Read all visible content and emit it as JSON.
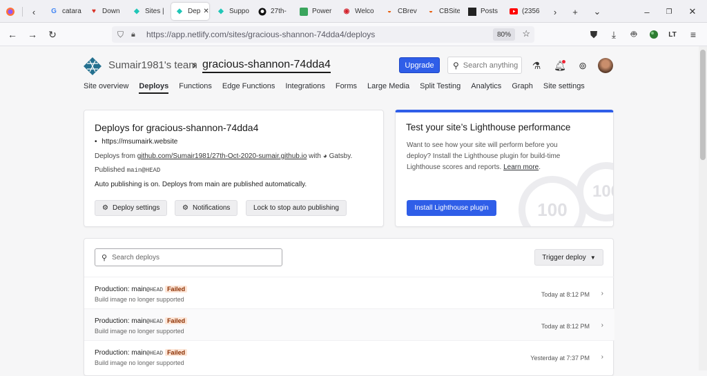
{
  "browser": {
    "tabs": [
      {
        "label": "catara",
        "icon": "google-icon"
      },
      {
        "label": "Down",
        "icon": "heart-icon"
      },
      {
        "label": "Sites |",
        "icon": "netlify-icon"
      },
      {
        "label": "Dep",
        "icon": "netlify-icon"
      },
      {
        "label": "Suppo",
        "icon": "netlify-icon"
      },
      {
        "label": "27th-",
        "icon": "github-icon"
      },
      {
        "label": "Power",
        "icon": "frog-icon"
      },
      {
        "label": "Welco",
        "icon": "flame-icon"
      },
      {
        "label": "CBrev",
        "icon": "cb-icon"
      },
      {
        "label": "CBSite",
        "icon": "cb-icon"
      },
      {
        "label": "Posts",
        "icon": "posts-icon"
      },
      {
        "label": "(2356",
        "icon": "youtube-icon"
      }
    ],
    "url": "https://app.netlify.com/sites/gracious-shannon-74dda4/deploys",
    "zoom": "80%"
  },
  "header": {
    "team": "Sumair1981's team",
    "site": "gracious-shannon-74dda4",
    "upgrade": "Upgrade",
    "search_placeholder": "Search anything"
  },
  "subnav": [
    "Site overview",
    "Deploys",
    "Functions",
    "Edge Functions",
    "Integrations",
    "Forms",
    "Large Media",
    "Split Testing",
    "Analytics",
    "Graph",
    "Site settings"
  ],
  "deploys_card": {
    "title": "Deploys for gracious-shannon-74dda4",
    "site_url": "https://msumairk.website",
    "deploys_from_prefix": "Deploys from ",
    "repo": "github.com/Sumair1981/27th-Oct-2020-sumair.github.io",
    "with": " with ",
    "framework": "Gatsby.",
    "published_prefix": "Published ",
    "published_ref": "main@HEAD",
    "auto_publishing": "Auto publishing is on. Deploys from main are published automatically.",
    "btn_deploy_settings": "Deploy settings",
    "btn_notifications": "Notifications",
    "btn_lock": "Lock to stop auto publishing"
  },
  "lighthouse_card": {
    "title": "Test your site’s Lighthouse performance",
    "text": "Want to see how your site will perform before you deploy? Install the Lighthouse plugin for build-time Lighthouse scores and reports.",
    "learn_more": "Learn more",
    "button": "Install Lighthouse plugin",
    "score1": "100",
    "score2": "100"
  },
  "deploy_list": {
    "search_placeholder": "Search deploys",
    "trigger": "Trigger deploy",
    "rows": [
      {
        "prefix": "Production: main",
        "ref": "@HEAD",
        "status": "Failed",
        "sub": "Build image no longer supported",
        "time": "Today at 8:12 PM"
      },
      {
        "prefix": "Production: main",
        "ref": "@HEAD",
        "status": "Failed",
        "sub": "Build image no longer supported",
        "time": "Today at 8:12 PM"
      },
      {
        "prefix": "Production: main",
        "ref": "@HEAD",
        "status": "Failed",
        "sub": "Build image no longer supported",
        "time": "Yesterday at 7:37 PM"
      }
    ]
  },
  "colors": {
    "accent": "#2f5ee8",
    "failed_bg": "#fde5d6"
  }
}
